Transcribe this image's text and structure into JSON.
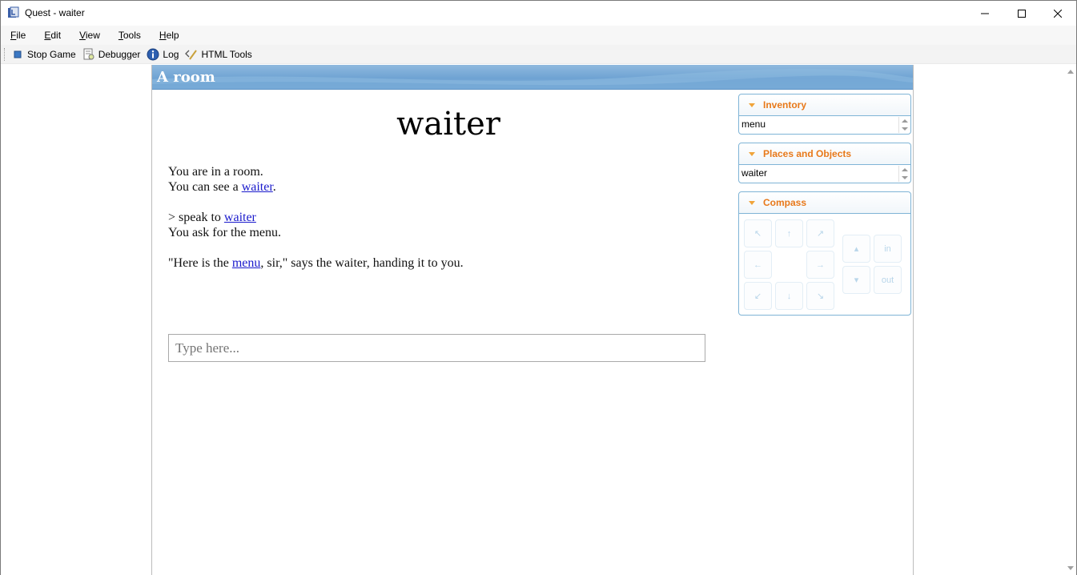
{
  "window": {
    "title": "Quest - waiter"
  },
  "menu": {
    "items": [
      {
        "label": "File",
        "accel": "F",
        "rest": "ile"
      },
      {
        "label": "Edit",
        "accel": "E",
        "rest": "dit"
      },
      {
        "label": "View",
        "accel": "V",
        "rest": "iew"
      },
      {
        "label": "Tools",
        "accel": "T",
        "rest": "ools"
      },
      {
        "label": "Help",
        "accel": "H",
        "rest": "elp"
      }
    ]
  },
  "toolbar": {
    "stop_game": "Stop Game",
    "debugger": "Debugger",
    "log": "Log",
    "html_tools": "HTML Tools"
  },
  "location": {
    "title": "A room"
  },
  "output": {
    "heading": "waiter",
    "line1": "You are in a room.",
    "line2_prefix": "You can see a ",
    "line2_link": "waiter",
    "line2_suffix": ".",
    "cmd_prefix": "> speak to ",
    "cmd_link": "waiter",
    "line3": "You ask for the menu.",
    "line4_prefix": "\"Here is the ",
    "line4_link": "menu",
    "line4_suffix": ", sir,\" says the waiter, handing it to you."
  },
  "command_input": {
    "placeholder": "Type here..."
  },
  "panes": {
    "inventory": {
      "title": "Inventory",
      "item": "menu"
    },
    "places": {
      "title": "Places and Objects",
      "item": "waiter"
    },
    "compass": {
      "title": "Compass",
      "in_label": "in",
      "out_label": "out"
    }
  },
  "colors": {
    "pane_title": "#e8791a",
    "pane_border": "#7fb4d6",
    "location_bar": "#6fa3d3",
    "link": "#1a1acc"
  }
}
